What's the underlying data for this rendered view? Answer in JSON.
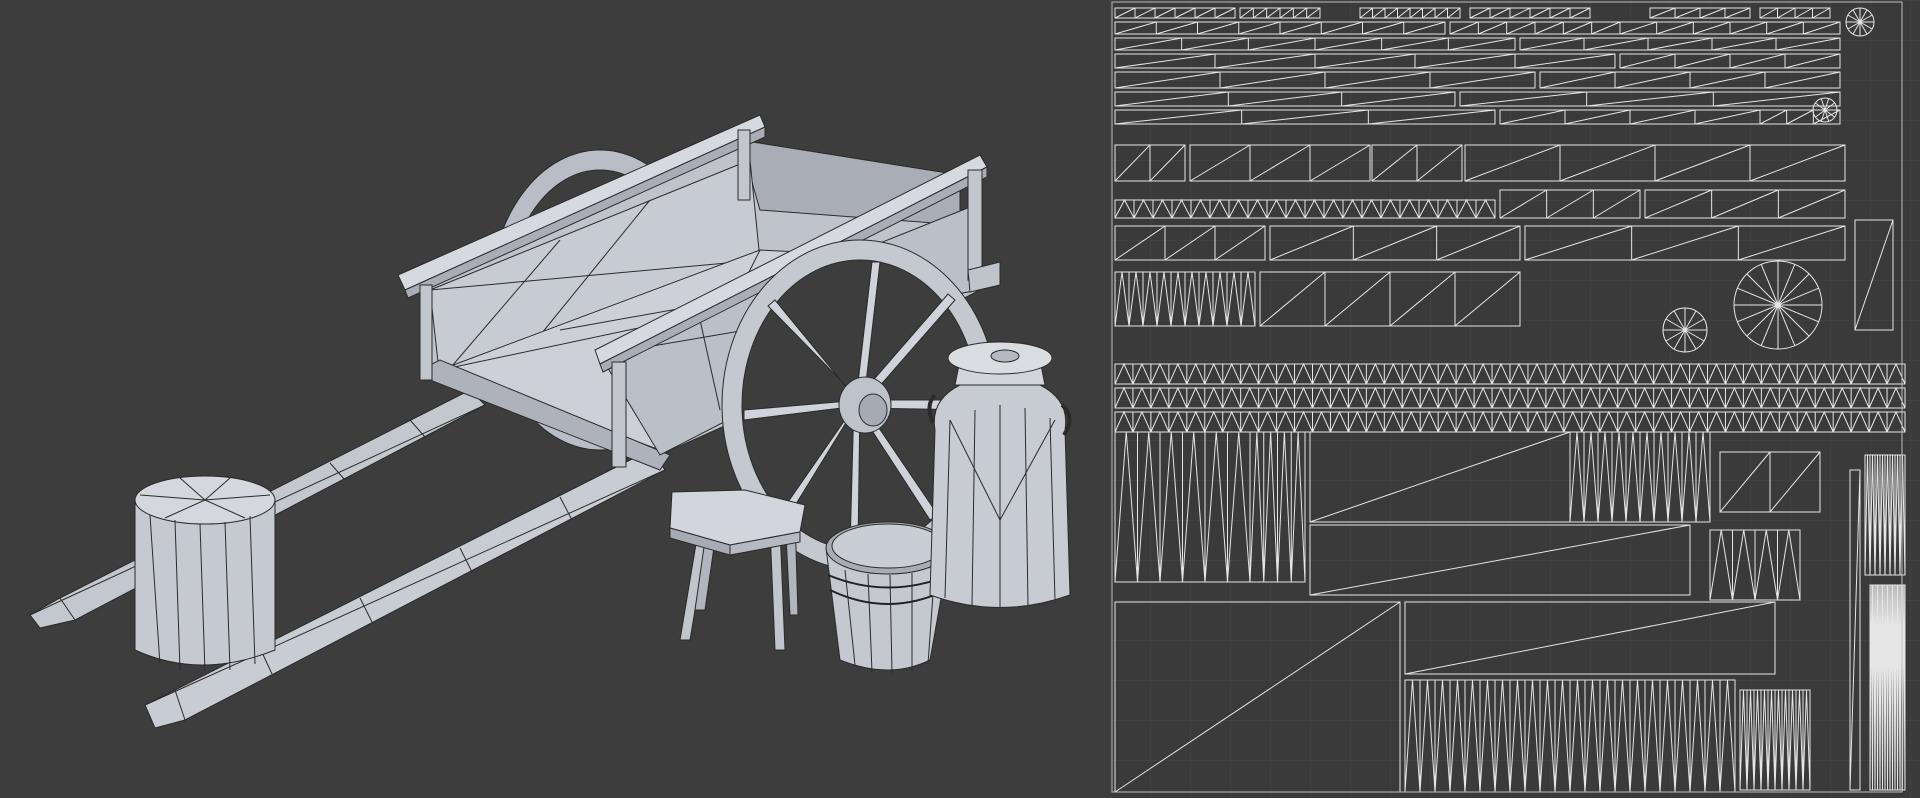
{
  "colors": {
    "viewport_bg": "#3d3d3d",
    "uv_bg": "#3a3a3a",
    "mesh_fill": "#c8ccd3",
    "mesh_shade": "#aeb3bb",
    "mesh_dark": "#9aa0a9",
    "wire": "#2b2b2b",
    "uv_line": "#e6e6e6",
    "uv_grid": "#474747"
  },
  "panels": {
    "viewport_name": "3d-viewport",
    "uv_name": "uv-editor"
  }
}
